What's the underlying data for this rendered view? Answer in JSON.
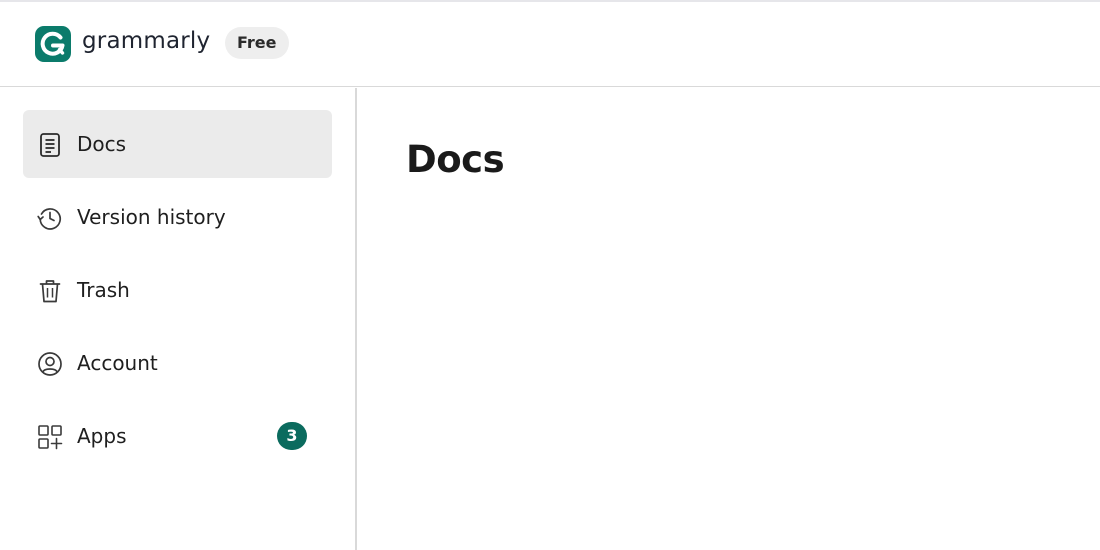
{
  "brand": {
    "name": "grammarly",
    "plan": "Free",
    "logo_icon": "grammarly-g-icon",
    "accent_color": "#0b7b6b"
  },
  "sidebar": {
    "items": [
      {
        "label": "Docs",
        "icon": "document-icon",
        "active": true
      },
      {
        "label": "Version history",
        "icon": "history-icon",
        "active": false
      },
      {
        "label": "Trash",
        "icon": "trash-icon",
        "active": false
      },
      {
        "label": "Account",
        "icon": "account-icon",
        "active": false
      },
      {
        "label": "Apps",
        "icon": "apps-grid-icon",
        "active": false,
        "badge": "3"
      }
    ]
  },
  "main": {
    "title": "Docs"
  }
}
